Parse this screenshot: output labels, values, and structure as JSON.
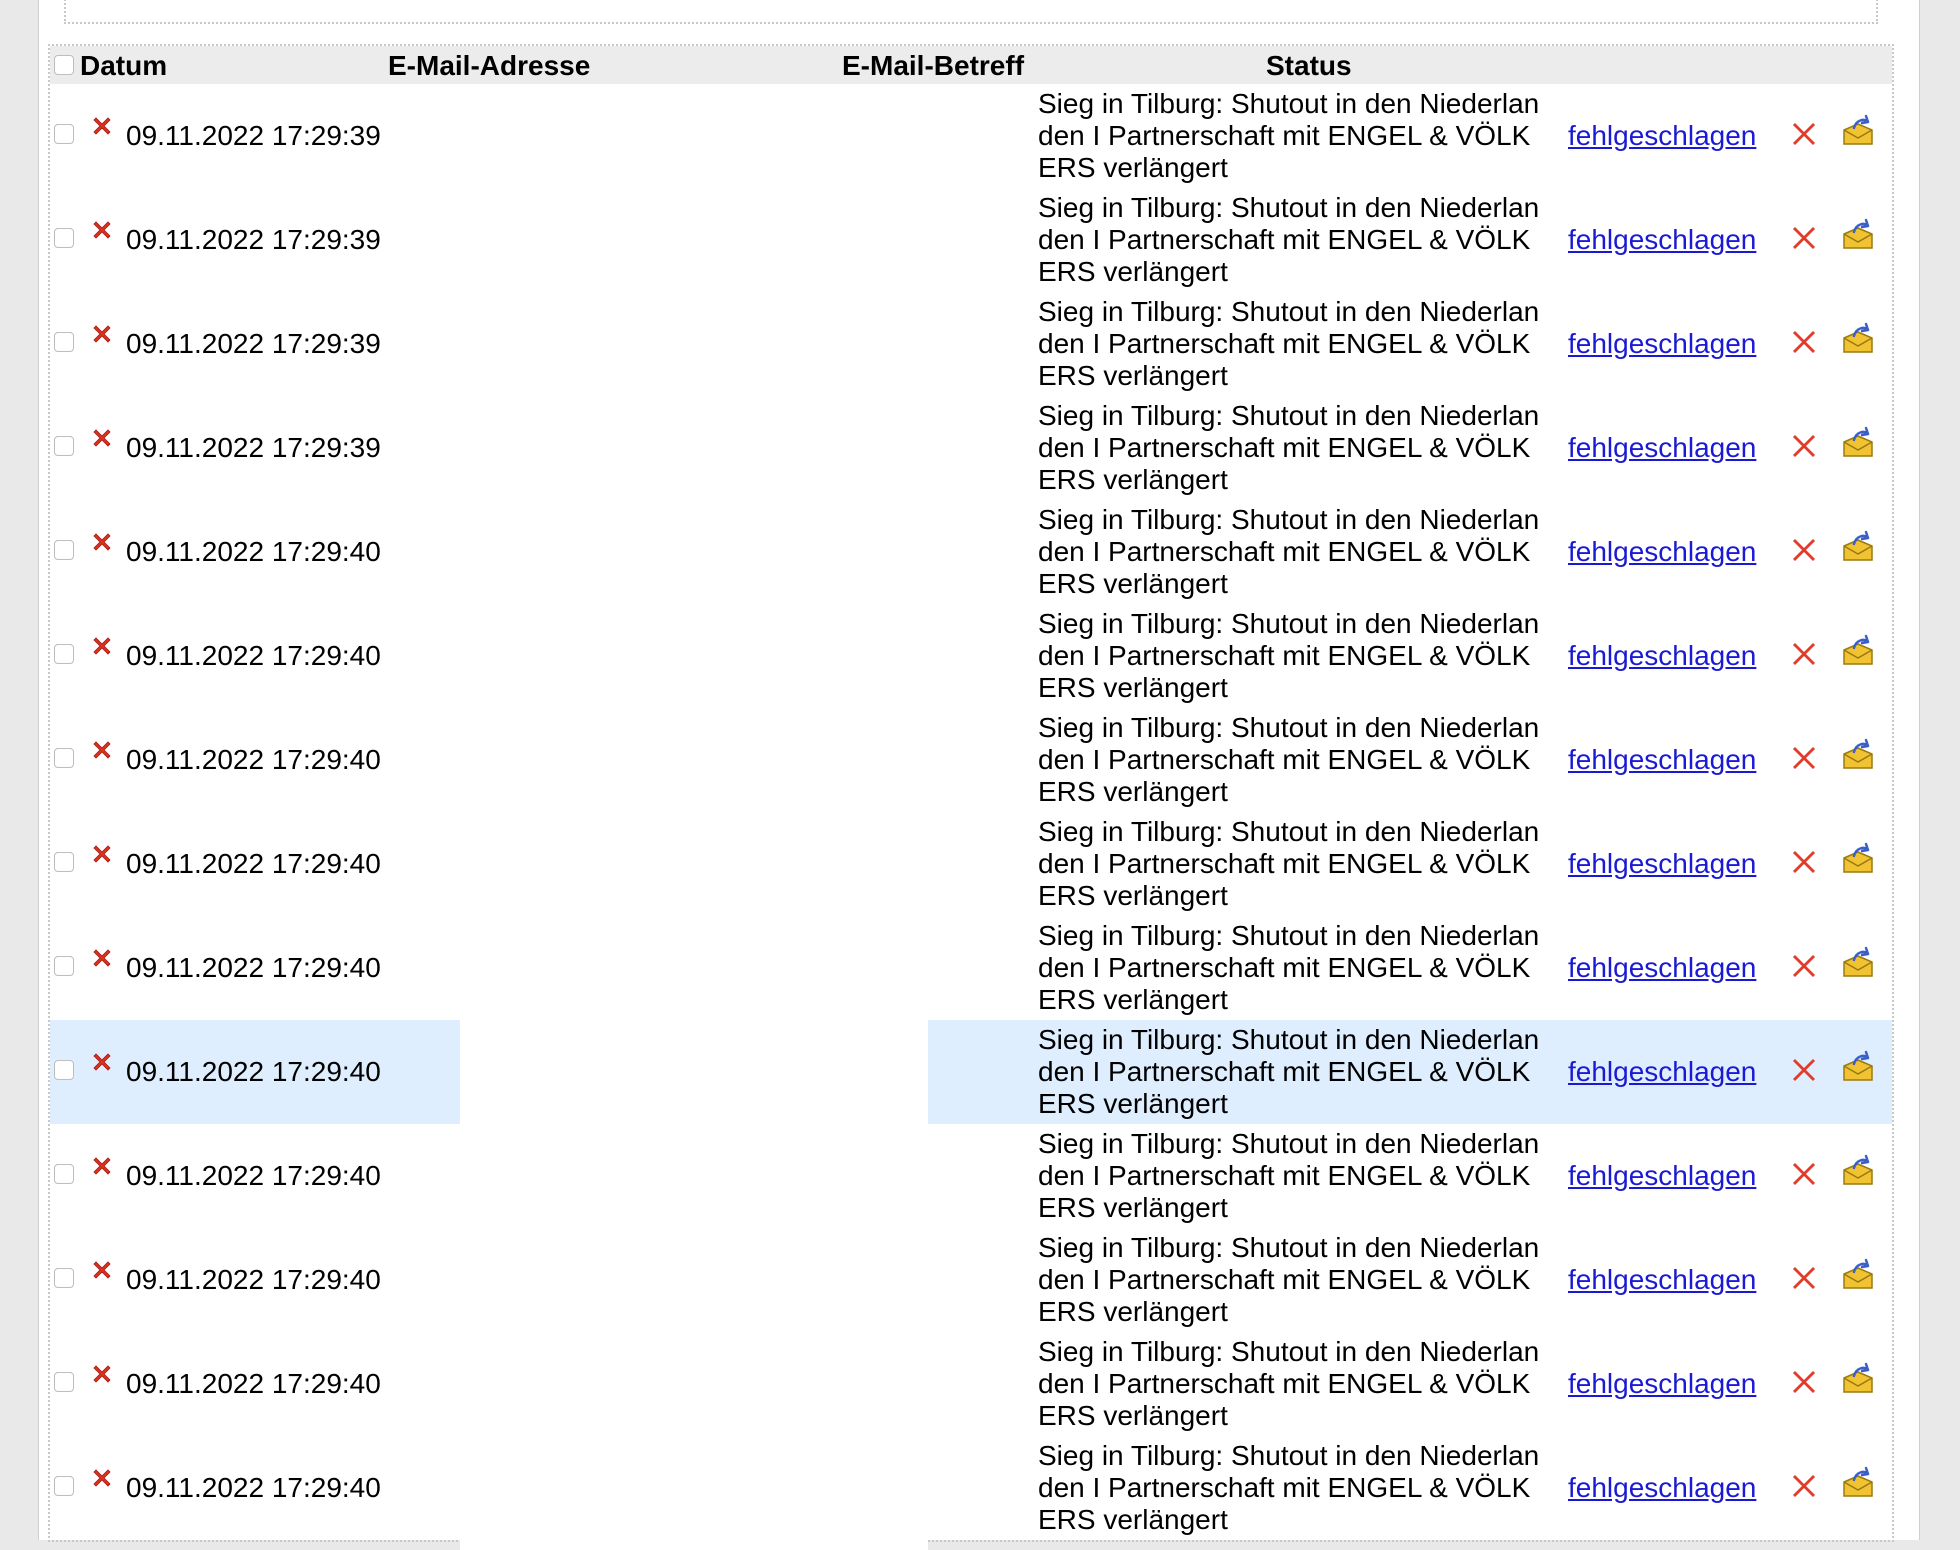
{
  "table": {
    "headers": {
      "date": "Datum",
      "email": "E-Mail-Adresse",
      "subject": "E-Mail-Betreff",
      "status": "Status"
    },
    "rows": [
      {
        "date": "09.11.2022 17:29:39",
        "subject": "Sieg in Tilburg: Shutout in den Niederlan den I Partnerschaft mit ENGEL & VÖLK ERS verlängert",
        "status": "fehlgeschlagen"
      },
      {
        "date": "09.11.2022 17:29:39",
        "subject": "Sieg in Tilburg: Shutout in den Niederlan den I Partnerschaft mit ENGEL & VÖLK ERS verlängert",
        "status": "fehlgeschlagen"
      },
      {
        "date": "09.11.2022 17:29:39",
        "subject": "Sieg in Tilburg: Shutout in den Niederlan den I Partnerschaft mit ENGEL & VÖLK ERS verlängert",
        "status": "fehlgeschlagen"
      },
      {
        "date": "09.11.2022 17:29:39",
        "subject": "Sieg in Tilburg: Shutout in den Niederlan den I Partnerschaft mit ENGEL & VÖLK ERS verlängert",
        "status": "fehlgeschlagen"
      },
      {
        "date": "09.11.2022 17:29:40",
        "subject": "Sieg in Tilburg: Shutout in den Niederlan den I Partnerschaft mit ENGEL & VÖLK ERS verlängert",
        "status": "fehlgeschlagen"
      },
      {
        "date": "09.11.2022 17:29:40",
        "subject": "Sieg in Tilburg: Shutout in den Niederlan den I Partnerschaft mit ENGEL & VÖLK ERS verlängert",
        "status": "fehlgeschlagen"
      },
      {
        "date": "09.11.2022 17:29:40",
        "subject": "Sieg in Tilburg: Shutout in den Niederlan den I Partnerschaft mit ENGEL & VÖLK ERS verlängert",
        "status": "fehlgeschlagen"
      },
      {
        "date": "09.11.2022 17:29:40",
        "subject": "Sieg in Tilburg: Shutout in den Niederlan den I Partnerschaft mit ENGEL & VÖLK ERS verlängert",
        "status": "fehlgeschlagen"
      },
      {
        "date": "09.11.2022 17:29:40",
        "subject": "Sieg in Tilburg: Shutout in den Niederlan den I Partnerschaft mit ENGEL & VÖLK ERS verlängert",
        "status": "fehlgeschlagen"
      },
      {
        "date": "09.11.2022 17:29:40",
        "subject": "Sieg in Tilburg: Shutout in den Niederlan den I Partnerschaft mit ENGEL & VÖLK ERS verlängert",
        "status": "fehlgeschlagen"
      },
      {
        "date": "09.11.2022 17:29:40",
        "subject": "Sieg in Tilburg: Shutout in den Niederlan den I Partnerschaft mit ENGEL & VÖLK ERS verlängert",
        "status": "fehlgeschlagen"
      },
      {
        "date": "09.11.2022 17:29:40",
        "subject": "Sieg in Tilburg: Shutout in den Niederlan den I Partnerschaft mit ENGEL & VÖLK ERS verlängert",
        "status": "fehlgeschlagen"
      },
      {
        "date": "09.11.2022 17:29:40",
        "subject": "Sieg in Tilburg: Shutout in den Niederlan den I Partnerschaft mit ENGEL & VÖLK ERS verlängert",
        "status": "fehlgeschlagen"
      },
      {
        "date": "09.11.2022 17:29:40",
        "subject": "Sieg in Tilburg: Shutout in den Niederlan den I Partnerschaft mit ENGEL & VÖLK ERS verlängert",
        "status": "fehlgeschlagen"
      }
    ],
    "highlighted_row": 9
  },
  "icons": {
    "row_status": "red-x-icon",
    "delete_action": "delete-icon",
    "resend_action": "resend-mail-icon"
  },
  "colors": {
    "link": "#1a1ad6",
    "highlight": "#deeefe",
    "error_red": "#e0301e",
    "header_bg": "#ececec"
  }
}
